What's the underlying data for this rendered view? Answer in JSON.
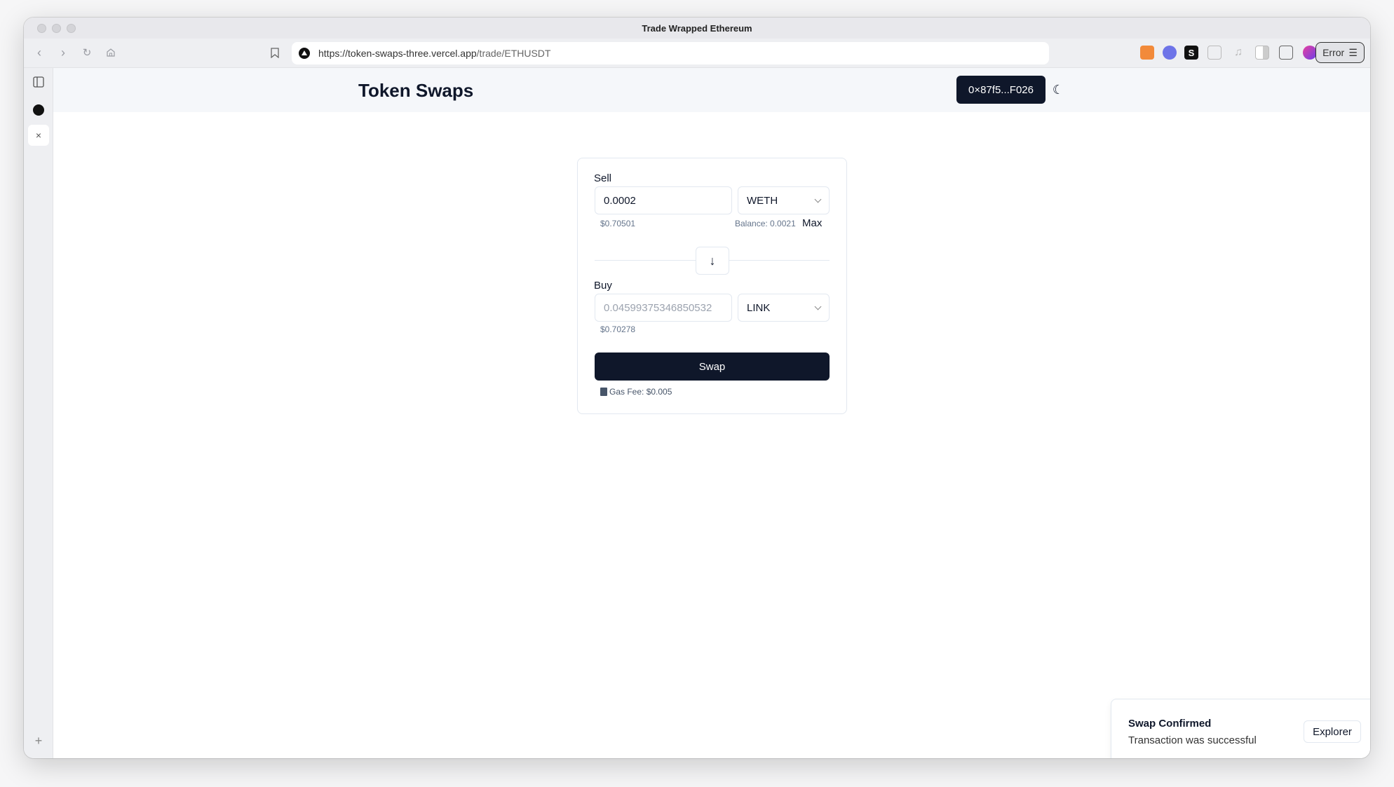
{
  "browser": {
    "window_title": "Trade Wrapped Ethereum",
    "url_host": "https://token-swaps-three.vercel.app",
    "url_path": "/trade/ETHUSDT",
    "error_button_label": "Error",
    "extensions": [
      "metamask-icon",
      "rabby-icon",
      "s-extension-icon",
      "puzzle-icon",
      "music-icon",
      "sidebar-icon",
      "wallet-icon",
      "globe-extension-icon"
    ]
  },
  "app": {
    "brand": "Token Swaps",
    "wallet_address": "0×87f5...F026",
    "theme_toggle_icon": "moon-icon"
  },
  "swap": {
    "sell": {
      "label": "Sell",
      "amount": "0.0002",
      "token": "WETH",
      "usd_value": "$0.70501",
      "balance": "Balance: 0.0021",
      "max_label": "Max"
    },
    "direction_icon": "↓",
    "buy": {
      "label": "Buy",
      "amount_placeholder": "0.04599375346850532",
      "token": "LINK",
      "usd_value": "$0.70278"
    },
    "swap_label": "Swap",
    "gas_fee": "Gas Fee: $0.005"
  },
  "toast": {
    "title": "Swap Confirmed",
    "description": "Transaction was successful",
    "action_label": "Explorer"
  },
  "sidebar": {
    "close_glyph": "×",
    "add_glyph": "+"
  }
}
